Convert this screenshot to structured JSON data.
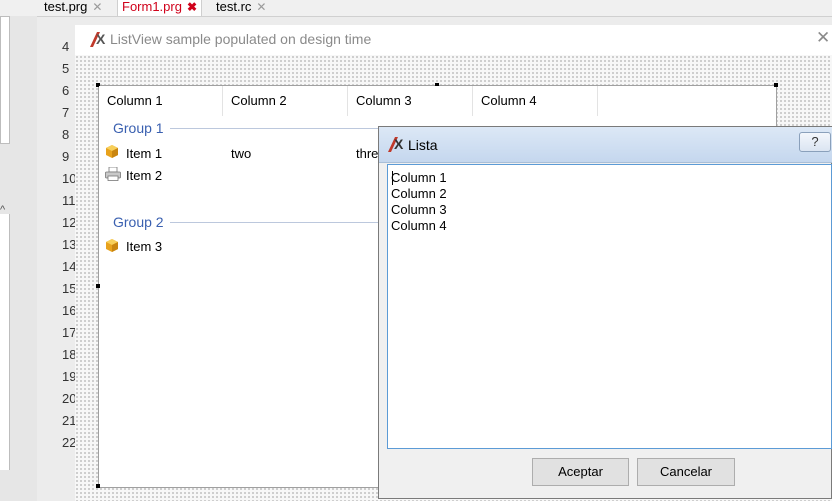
{
  "tabs": [
    {
      "label": "test.prg",
      "close": "✕"
    },
    {
      "label": "Form1.prg",
      "close": "✖"
    },
    {
      "label": "test.rc",
      "close": "✕"
    }
  ],
  "line_numbers": [
    "4",
    "5",
    "6",
    "7",
    "8",
    "9",
    "10",
    "11",
    "12",
    "13",
    "14",
    "15",
    "16",
    "17",
    "18",
    "19",
    "20",
    "21",
    "22"
  ],
  "form": {
    "title": "ListView sample populated on design time",
    "close": "✕"
  },
  "listview": {
    "columns": [
      "Column 1",
      "Column 2",
      "Column 3",
      "Column 4"
    ],
    "groups": [
      {
        "label": "Group 1",
        "items": [
          {
            "text": "Item 1",
            "icon": "cube-icon",
            "cells": [
              "two",
              "thre"
            ]
          },
          {
            "text": "Item 2",
            "icon": "printer-icon",
            "cells": []
          }
        ]
      },
      {
        "label": "Group 2",
        "items": [
          {
            "text": "Item 3",
            "icon": "cube-icon",
            "cells": []
          }
        ]
      }
    ]
  },
  "dialog": {
    "title": "Lista",
    "help": "?",
    "lines": [
      "Column 1",
      "Column 2",
      "Column 3",
      "Column 4"
    ],
    "ok": "Aceptar",
    "cancel": "Cancelar"
  },
  "colors": {
    "group": "#3a60b0",
    "active_tab": "#d0021b",
    "dialog_titlebar": "#d0e0f2"
  }
}
